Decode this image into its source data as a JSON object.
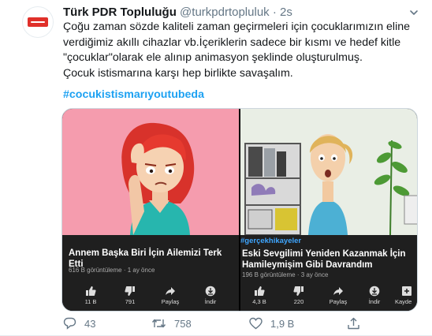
{
  "tweet": {
    "name": "Türk PDR Topluluğu",
    "handle": "@turkpdrtopluluk",
    "dot": " · ",
    "time": "2s",
    "text": "Çoğu zaman sözde kaliteli zaman geçirmeleri için çocuklarımızın eline\nverdiğimiz akıllı cihazlar vb.İçeriklerin sadece bir kısmı ve hedef kitle\n\"çocuklar\"olarak ele alınıp animasyon şeklinde oluşturulmuş.\nÇocuk istismarına karşı hep birlikte savaşalım.",
    "hashtag": "#cocukistismarıyoutubeda"
  },
  "videos": [
    {
      "title": "Annem Başka Biri İçin Ailemizi Terk Etti",
      "meta": "616 B görüntüleme · 1 ay önce",
      "actions": [
        {
          "icon": "like-icon",
          "label": "11 B"
        },
        {
          "icon": "dislike-icon",
          "label": "791"
        },
        {
          "icon": "share-icon",
          "label": "Paylaş"
        },
        {
          "icon": "download-icon",
          "label": "İndir"
        }
      ]
    },
    {
      "hashtag": "#gerçekhikayeler",
      "title": "Eski Sevgilimi Yeniden Kazanmak İçin Hamileymişim Gibi Davrandım",
      "meta": "196 B görüntüleme · 3 ay önce",
      "actions": [
        {
          "icon": "like-icon",
          "label": "4,3 B"
        },
        {
          "icon": "dislike-icon",
          "label": "220"
        },
        {
          "icon": "share-icon",
          "label": "Paylaş"
        },
        {
          "icon": "download-icon",
          "label": "İndir"
        },
        {
          "icon": "save-icon",
          "label": "Kayde"
        }
      ]
    }
  ],
  "footer": {
    "replies": "43",
    "retweets": "758",
    "likes": "1,9 B"
  }
}
